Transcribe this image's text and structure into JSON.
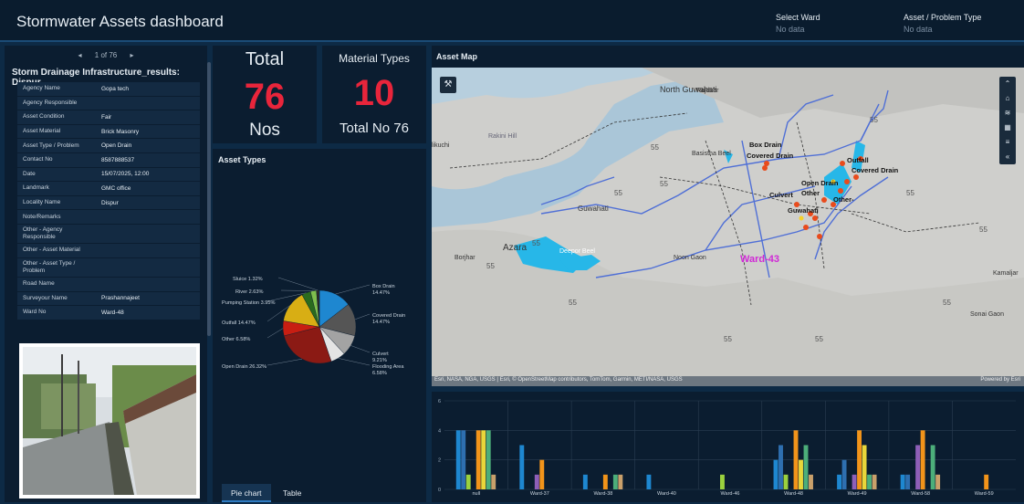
{
  "header": {
    "title": "Stormwater Assets dashboard",
    "ward_filter_label": "Select Ward",
    "ward_filter_value": "No data",
    "asset_filter_label": "Asset / Problem Type",
    "asset_filter_value": "No data"
  },
  "pager": {
    "prev": "◂",
    "text": "1 of 76",
    "next": "▸"
  },
  "record_title": "Storm Drainage Infrastructure_results: Dispur",
  "attributes": [
    {
      "k": "Agency Name",
      "v": "Gopa tech"
    },
    {
      "k": "Agency Responsible",
      "v": ""
    },
    {
      "k": "Asset Condition",
      "v": "Fair"
    },
    {
      "k": "Asset Material",
      "v": "Brick Masonry"
    },
    {
      "k": "Asset Type / Problem",
      "v": "Open Drain"
    },
    {
      "k": "Contact No",
      "v": "8587888537"
    },
    {
      "k": "Date",
      "v": "15/07/2025, 12:00"
    },
    {
      "k": "Landmark",
      "v": "GMC office"
    },
    {
      "k": "Locality Name",
      "v": "Dispur"
    },
    {
      "k": "Note/Remarks",
      "v": ""
    },
    {
      "k": "Other - Agency Responsible",
      "v": ""
    },
    {
      "k": "Other - Asset Material",
      "v": ""
    },
    {
      "k": "Other - Asset Type / Problem",
      "v": ""
    },
    {
      "k": "Road Name",
      "v": ""
    },
    {
      "k": "Surveyour Name",
      "v": "Prashannajeet"
    },
    {
      "k": "Ward No",
      "v": "Ward-48"
    }
  ],
  "total_card": {
    "title": "Total",
    "value": "76",
    "unit": "Nos"
  },
  "material_card": {
    "title": "Material Types",
    "value": "10",
    "subtitle": "Total No 76"
  },
  "asset_types_title": "Asset Types",
  "tabs": {
    "pie": "Pie chart",
    "table": "Table"
  },
  "map": {
    "title": "Asset Map",
    "attribution": "Esri, NASA, NGA, USGS | Esri, © OpenStreetMap contributors, TomTom, Garmin, METI/NASA, USGS",
    "powered": "Powered by Esri",
    "labels": [
      "North Guwahati",
      "Rajduar",
      "Rakini Hill",
      "Guwahati",
      "Azara",
      "Borjhar",
      "Deepor Beel",
      "Ward-43",
      "Sonai Gaon",
      "Kamaljar",
      "Box Drain",
      "Covered Drain",
      "Outfall",
      "Open Drain",
      "Culvert",
      "Other",
      "Other-",
      "Covered Drain",
      "Guwahati",
      "Basistha Beel",
      "likuchi",
      "Noon Gaon"
    ]
  },
  "colors": {
    "accent_red": "#e8253b",
    "panel": "#0b1d30",
    "bg": "#0d2a45"
  },
  "chart_data": [
    {
      "type": "pie",
      "title": "Asset Types",
      "slices": [
        {
          "label": "Box Drain",
          "value": 14.47,
          "color": "#1e87d0"
        },
        {
          "label": "Covered Drain",
          "value": 14.47,
          "color": "#555555"
        },
        {
          "label": "Culvert",
          "value": 9.21,
          "color": "#a3a3a3"
        },
        {
          "label": "Flooding Area",
          "value": 6.58,
          "color": "#e4e4e4"
        },
        {
          "label": "Open Drain",
          "value": 26.32,
          "color": "#8b1a14"
        },
        {
          "label": "Other",
          "value": 6.58,
          "color": "#c81e12"
        },
        {
          "label": "Outfall",
          "value": 14.47,
          "color": "#d8ae14"
        },
        {
          "label": "Pumping Station",
          "value": 3.95,
          "color": "#2a6b1e"
        },
        {
          "label": "River",
          "value": 2.63,
          "color": "#7fbf4d"
        },
        {
          "label": "Sluice",
          "value": 1.32,
          "color": "#2b2b2b"
        }
      ],
      "display_labels": [
        "Box Drain 14.47%",
        "Covered Drain 14.47%",
        "Culvert 9.21%",
        "Flooding Area 6.58%",
        "Open Drain 26.32%",
        "Other 6.58%",
        "Outfall 14.47%",
        "Pumping Station 3.95%",
        "River 2.63%",
        "Sluice 1.32%"
      ]
    },
    {
      "type": "bar",
      "categories": [
        "null",
        "Ward-37",
        "Ward-38",
        "Ward-40",
        "Ward-46",
        "Ward-48",
        "Ward-49",
        "Ward-58",
        "Ward-59"
      ],
      "ylim": [
        0,
        6
      ],
      "yticks": [
        "0",
        "2",
        "4",
        "6"
      ],
      "series_colors": [
        "#1e87d0",
        "#2e6fb0",
        "#9bd13e",
        "#8e5fb8",
        "#f2941a",
        "#e8d63a",
        "#4cae7a",
        "#c9a06b"
      ],
      "values": [
        [
          4,
          4,
          1,
          0,
          4,
          4,
          4,
          1
        ],
        [
          3,
          0,
          0,
          1,
          2,
          0,
          0,
          0
        ],
        [
          1,
          0,
          0,
          0,
          1,
          0,
          1,
          1
        ],
        [
          1,
          0,
          0,
          0,
          0,
          0,
          0,
          0
        ],
        [
          0,
          0,
          1,
          0,
          0,
          0,
          0,
          0
        ],
        [
          2,
          3,
          1,
          0,
          4,
          2,
          3,
          1
        ],
        [
          1,
          2,
          0,
          1,
          4,
          3,
          1,
          1
        ],
        [
          1,
          1,
          0,
          3,
          4,
          0,
          3,
          1
        ],
        [
          0,
          0,
          0,
          0,
          1,
          0,
          0,
          0
        ]
      ]
    }
  ]
}
